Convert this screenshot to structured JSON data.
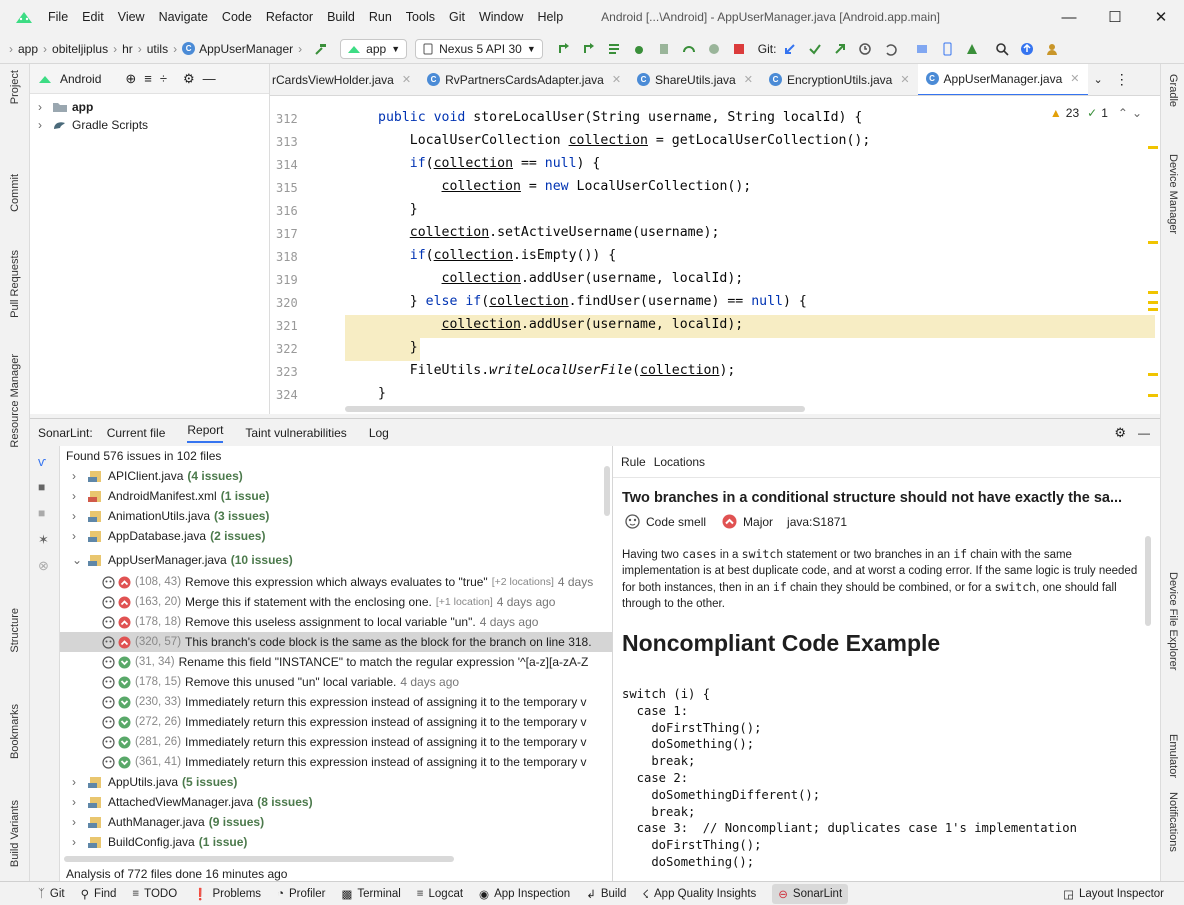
{
  "menu": [
    "File",
    "Edit",
    "View",
    "Navigate",
    "Code",
    "Refactor",
    "Build",
    "Run",
    "Tools",
    "Git",
    "Window",
    "Help"
  ],
  "window_title": "Android [...\\Android] - AppUserManager.java [Android.app.main]",
  "breadcrumbs": [
    "app",
    "obiteljiplus",
    "hr",
    "utils",
    "AppUserManager"
  ],
  "run_config": "app",
  "device": "Nexus 5 API 30",
  "git_label": "Git:",
  "project": {
    "view_label": "Android",
    "tree": [
      {
        "label": "app",
        "bold": true
      },
      {
        "label": "Gradle Scripts",
        "bold": false
      }
    ]
  },
  "left_tool_windows": [
    "Project",
    "Commit",
    "Pull Requests",
    "Resource Manager",
    "Structure",
    "Bookmarks",
    "Build Variants"
  ],
  "right_tool_windows": [
    "Gradle",
    "Device Manager",
    "Device File Explorer",
    "Emulator",
    "Notifications"
  ],
  "editor_tabs": [
    {
      "label": "rCardsViewHolder.java",
      "active": false
    },
    {
      "label": "RvPartnersCardsAdapter.java",
      "active": false
    },
    {
      "label": "ShareUtils.java",
      "active": false
    },
    {
      "label": "EncryptionUtils.java",
      "active": false
    },
    {
      "label": "AppUserManager.java",
      "active": true
    }
  ],
  "inspection": {
    "warnings": "23",
    "ok": "1"
  },
  "code": {
    "line_numbers": [
      "312",
      "313",
      "314",
      "315",
      "316",
      "317",
      "318",
      "319",
      "320",
      "321",
      "322",
      "323",
      "324"
    ],
    "highlighted_lines": [
      "321",
      "322"
    ]
  },
  "sonar": {
    "label": "SonarLint:",
    "tabs": [
      "Current file",
      "Report",
      "Taint vulnerabilities",
      "Log"
    ],
    "active_tab": "Report",
    "summary": "Found 576 issues in 102 files",
    "files_before": [
      {
        "name": "APIClient.java",
        "count": "(4 issues)",
        "xml": false
      },
      {
        "name": "AndroidManifest.xml",
        "count": "(1 issue)",
        "xml": true
      },
      {
        "name": "AnimationUtils.java",
        "count": "(3 issues)",
        "xml": false
      },
      {
        "name": "AppDatabase.java",
        "count": "(2 issues)",
        "xml": false
      }
    ],
    "expanded_file": {
      "name": "AppUserManager.java",
      "count": "(10 issues)"
    },
    "issues": [
      {
        "pos": "(108, 43)",
        "text": "Remove this expression which always evaluates to \"true\"",
        "extra": "[+2 locations]",
        "ago": "4 days",
        "severity": "major",
        "selected": false
      },
      {
        "pos": "(163, 20)",
        "text": "Merge this if statement with the enclosing one.",
        "extra": "[+1 location]",
        "ago": "4 days ago",
        "severity": "major",
        "selected": false
      },
      {
        "pos": "(178, 18)",
        "text": "Remove this useless assignment to local variable \"un\".",
        "extra": "",
        "ago": "4 days ago",
        "severity": "major",
        "selected": false
      },
      {
        "pos": "(320, 57)",
        "text": "This branch's code block is the same as the block for the branch on line 318.",
        "extra": "",
        "ago": "",
        "severity": "major",
        "selected": true
      },
      {
        "pos": "(31, 34)",
        "text": "Rename this field \"INSTANCE\" to match the regular expression '^[a-z][a-zA-Z",
        "extra": "",
        "ago": "",
        "severity": "minor",
        "selected": false
      },
      {
        "pos": "(178, 15)",
        "text": "Remove this unused \"un\" local variable.",
        "extra": "",
        "ago": "4 days ago",
        "severity": "minor",
        "selected": false
      },
      {
        "pos": "(230, 33)",
        "text": "Immediately return this expression instead of assigning it to the temporary v",
        "extra": "",
        "ago": "",
        "severity": "minor",
        "selected": false
      },
      {
        "pos": "(272, 26)",
        "text": "Immediately return this expression instead of assigning it to the temporary v",
        "extra": "",
        "ago": "",
        "severity": "minor",
        "selected": false
      },
      {
        "pos": "(281, 26)",
        "text": "Immediately return this expression instead of assigning it to the temporary v",
        "extra": "",
        "ago": "",
        "severity": "minor",
        "selected": false
      },
      {
        "pos": "(361, 41)",
        "text": "Immediately return this expression instead of assigning it to the temporary v",
        "extra": "",
        "ago": "",
        "severity": "minor",
        "selected": false
      }
    ],
    "files_after": [
      {
        "name": "AppUtils.java",
        "count": "(5 issues)"
      },
      {
        "name": "AttachedViewManager.java",
        "count": "(8 issues)"
      },
      {
        "name": "AuthManager.java",
        "count": "(9 issues)"
      },
      {
        "name": "BuildConfig.java",
        "count": "(1 issue)"
      }
    ],
    "analysis_status": "Analysis of 772 files done 16 minutes ago"
  },
  "rule": {
    "tabs": [
      "Rule",
      "Locations"
    ],
    "title": "Two branches in a conditional structure should not have exactly the sa...",
    "type": "Code smell",
    "severity": "Major",
    "key": "java:S1871",
    "description": {
      "p1": "Having two ",
      "c1": "cases",
      "p2": " in a ",
      "c2": "switch",
      "p3": " statement or two branches in an ",
      "c3": "if",
      "p4": " chain with the same implementation is at best duplicate code, and at worst a coding error. If the same logic is truly needed for both instances, then in an ",
      "c4": "if",
      "p5": " chain they should be combined, or for a ",
      "c5": "switch",
      "p6": ", one should fall through to the other."
    },
    "heading": "Noncompliant Code Example",
    "code": "switch (i) {\n  case 1:\n    doFirstThing();\n    doSomething();\n    break;\n  case 2:\n    doSomethingDifferent();\n    break;\n  case 3:  // Noncompliant; duplicates case 1's implementation\n    doFirstThing();\n    doSomething();"
  },
  "statusbar": {
    "items": [
      "Git",
      "Find",
      "TODO",
      "Problems",
      "Profiler",
      "Terminal",
      "Logcat",
      "App Inspection",
      "Build",
      "App Quality Insights",
      "SonarLint"
    ],
    "active": "SonarLint",
    "right": "Layout Inspector"
  },
  "colors": {
    "accent": "#3574f0",
    "highlight": "#f7edc4",
    "keyword": "#0033b3",
    "field": "#871094",
    "major": "#e05252",
    "minor": "#59a869"
  }
}
